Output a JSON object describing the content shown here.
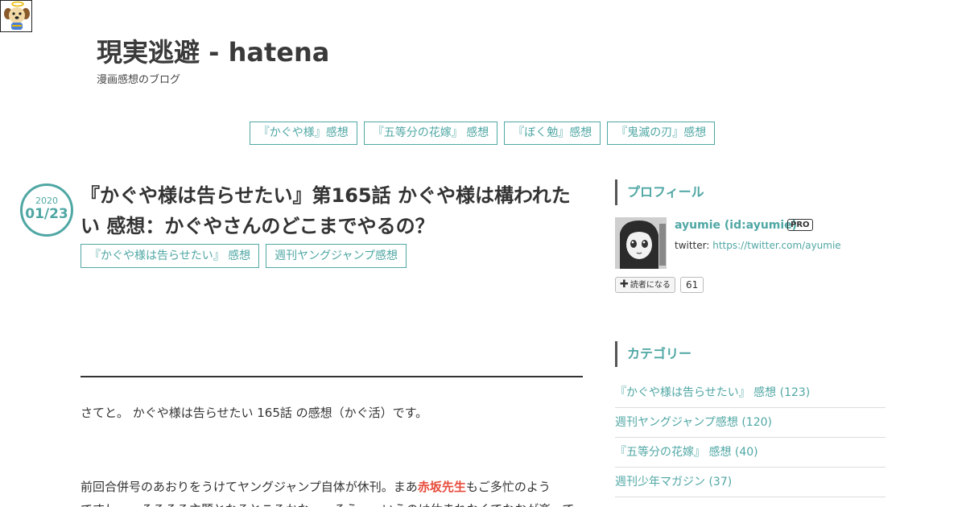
{
  "header": {
    "blog_title": "現実逃避 - hatena",
    "blog_description": "漫画感想のブログ"
  },
  "global_nav": [
    {
      "label": "『かぐや様』感想"
    },
    {
      "label": "『五等分の花嫁』 感想"
    },
    {
      "label": "『ぼく勉』感想"
    },
    {
      "label": "『鬼滅の刃』感想"
    }
  ],
  "entry": {
    "date_year": "2020",
    "date_month_day": "01/23",
    "title": "『かぐや様は告らせたい』第165話 かぐや様は構われたい 感想：かぐやさんのどこまでやるの？",
    "categories": [
      {
        "label": "『かぐや様は告らせたい』 感想"
      },
      {
        "label": "週刊ヤングジャンプ感想"
      }
    ],
    "paragraph1": "さてと。 かぐや様は告らせたい 165話 の感想（かぐ活）です。",
    "paragraph2_before": "前回合併号のあおりをうけてヤングジャンプ自体が休刊。まあ",
    "paragraph2_highlight": "赤坂先生",
    "paragraph2_after": "もご多忙のよう",
    "paragraph3_partial": "ですし……そろそろ主題となるところかな……そう……いうのは休まれなくてなおが楽ってると"
  },
  "sidebar": {
    "profile": {
      "heading": "プロフィール",
      "name": "ayumie (id:ayumie)",
      "pro_badge": "PRO",
      "twitter_label": "twitter: ",
      "twitter_link": "https://twitter.com/ayumie",
      "subscribe_label": "読者になる",
      "subscriber_count": "61"
    },
    "categories": {
      "heading": "カテゴリー",
      "items": [
        {
          "label": "『かぐや様は告らせたい』 感想 (123)"
        },
        {
          "label": "週刊ヤングジャンプ感想 (120)"
        },
        {
          "label": "『五等分の花嫁』 感想 (40)"
        },
        {
          "label": "週刊少年マガジン (37)"
        }
      ]
    }
  },
  "colors": {
    "accent": "#4fa7a4",
    "text": "#333333",
    "highlight": "#e74c3c"
  }
}
